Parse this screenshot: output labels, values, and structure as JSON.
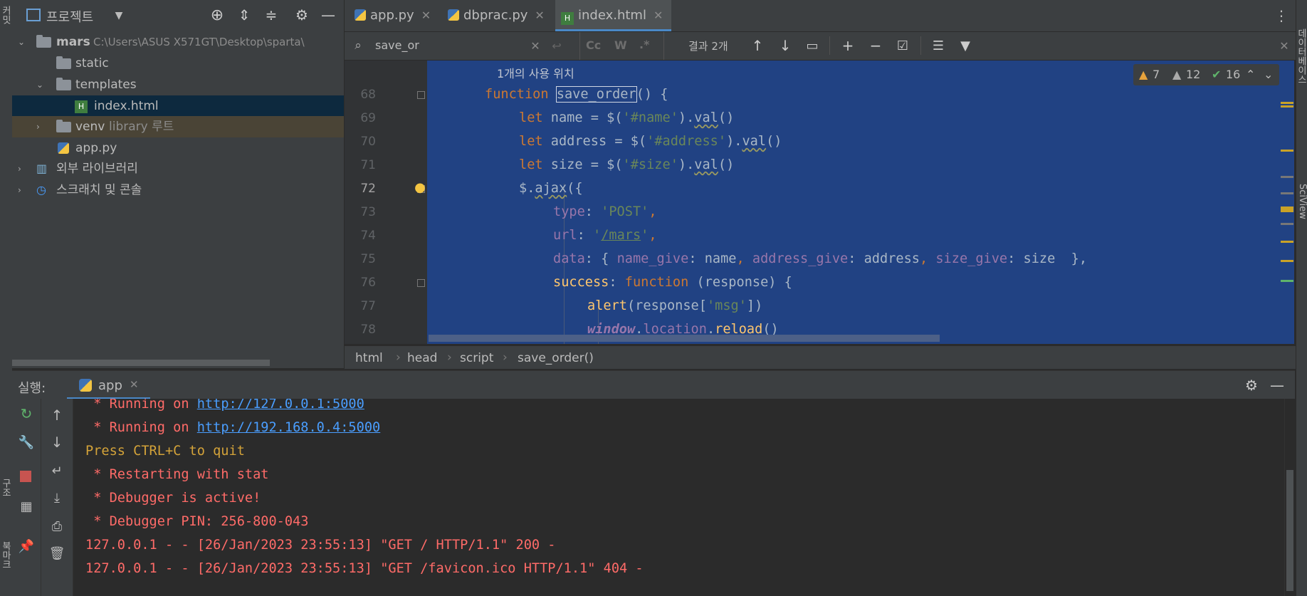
{
  "left_strip": {
    "top_label": "커밋",
    "bottom_label_1": "구조",
    "bottom_label_2": "북마크"
  },
  "project": {
    "title": "프로젝트",
    "root": {
      "name": "mars",
      "path": "C:\\Users\\ASUS X571GT\\Desktop\\sparta\\"
    },
    "items": [
      {
        "label": "static"
      },
      {
        "label": "templates"
      },
      {
        "label": "index.html"
      },
      {
        "label": "venv",
        "suffix": "library 루트"
      },
      {
        "label": "app.py"
      },
      {
        "label": "외부 라이브러리"
      },
      {
        "label": "스크래치 및 콘솔"
      }
    ]
  },
  "tabs": [
    {
      "label": "app.py",
      "icon": "python-file-icon"
    },
    {
      "label": "dbprac.py",
      "icon": "python-file-icon"
    },
    {
      "label": "index.html",
      "icon": "html-file-icon",
      "active": true
    }
  ],
  "search": {
    "query": "save_or",
    "opt_case": "Cc",
    "opt_word": "W",
    "opt_regex": ".*",
    "result": "결과 2개"
  },
  "inspections": {
    "warnings": "7",
    "weak_warnings": "12",
    "typos": "16"
  },
  "editor": {
    "usage_hint": "1개의 사용 위치",
    "line_numbers": [
      "68",
      "69",
      "70",
      "71",
      "72",
      "73",
      "74",
      "75",
      "76",
      "77",
      "78"
    ],
    "lines": {
      "l68": {
        "kw": "function ",
        "name": "save_order",
        "rest": "() {"
      },
      "l69": {
        "kw": "let ",
        "a": "name = $(",
        "s": "'#name'",
        "b": ").",
        "m": "val",
        "c": "()"
      },
      "l70": {
        "kw": "let ",
        "a": "address = $(",
        "s": "'#address'",
        "b": ").",
        "m": "val",
        "c": "()"
      },
      "l71": {
        "kw": "let ",
        "a": "size = $(",
        "s": "'#size'",
        "b": ").",
        "m": "val",
        "c": "()"
      },
      "l72": {
        "a": "$.",
        "m": "ajax",
        "b": "({"
      },
      "l73": {
        "p": "type",
        "a": ": ",
        "s": "'POST'",
        "c": ","
      },
      "l74": {
        "p": "url",
        "a": ": ",
        "s1": "'",
        "su": "/mars",
        "s2": "'",
        "c": ","
      },
      "l75": {
        "p": "data",
        "a": ": { ",
        "p1": "name_give",
        "a1": ": name",
        "c1": ", ",
        "p2": "address_give",
        "a2": ": address",
        "c2": ", ",
        "p3": "size_give",
        "a3": ": size  },"
      },
      "l76": {
        "p": "success",
        "a": ": ",
        "kw": "function",
        "b": " (response) {"
      },
      "l77": {
        "f": "alert",
        "a": "(response[",
        "s": "'msg'",
        "b": "])"
      },
      "l78": {
        "p": "window",
        "a": ".",
        "p2": "location",
        "b": ".",
        "f": "reload",
        "c": "()"
      }
    }
  },
  "breadcrumb": [
    "html",
    "head",
    "script",
    "save_order()"
  ],
  "run": {
    "label": "실행:",
    "tab": "app",
    "console": [
      {
        "text": " * Running on ",
        "link": "http://127.0.0.1:5000",
        "color": "#ff6b68"
      },
      {
        "text": " * Running on ",
        "link": "http://192.168.0.4:5000",
        "color": "#ff6b68"
      },
      {
        "text": "Press CTRL+C to quit",
        "color": "#d4a339"
      },
      {
        "text": " * Restarting with stat",
        "color": "#ff6b68"
      },
      {
        "text": " * Debugger is active!",
        "color": "#ff6b68"
      },
      {
        "text": " * Debugger PIN: 256-800-043",
        "color": "#ff6b68"
      },
      {
        "text": "127.0.0.1 - - [26/Jan/2023 23:55:13] \"GET / HTTP/1.1\" 200 -",
        "color": "#ff6b68"
      },
      {
        "text": "127.0.0.1 - - [26/Jan/2023 23:55:13] \"GET /favicon.ico HTTP/1.1\" 404 -",
        "color": "#ff6b68"
      }
    ]
  },
  "right_strip": {
    "label_1": "데이터베이스",
    "label_2": "SciView"
  },
  "colors": {
    "selection": "#214283",
    "keyword": "#cc7832",
    "string": "#6a8759",
    "property": "#9876aa",
    "function": "#ffc66d"
  }
}
